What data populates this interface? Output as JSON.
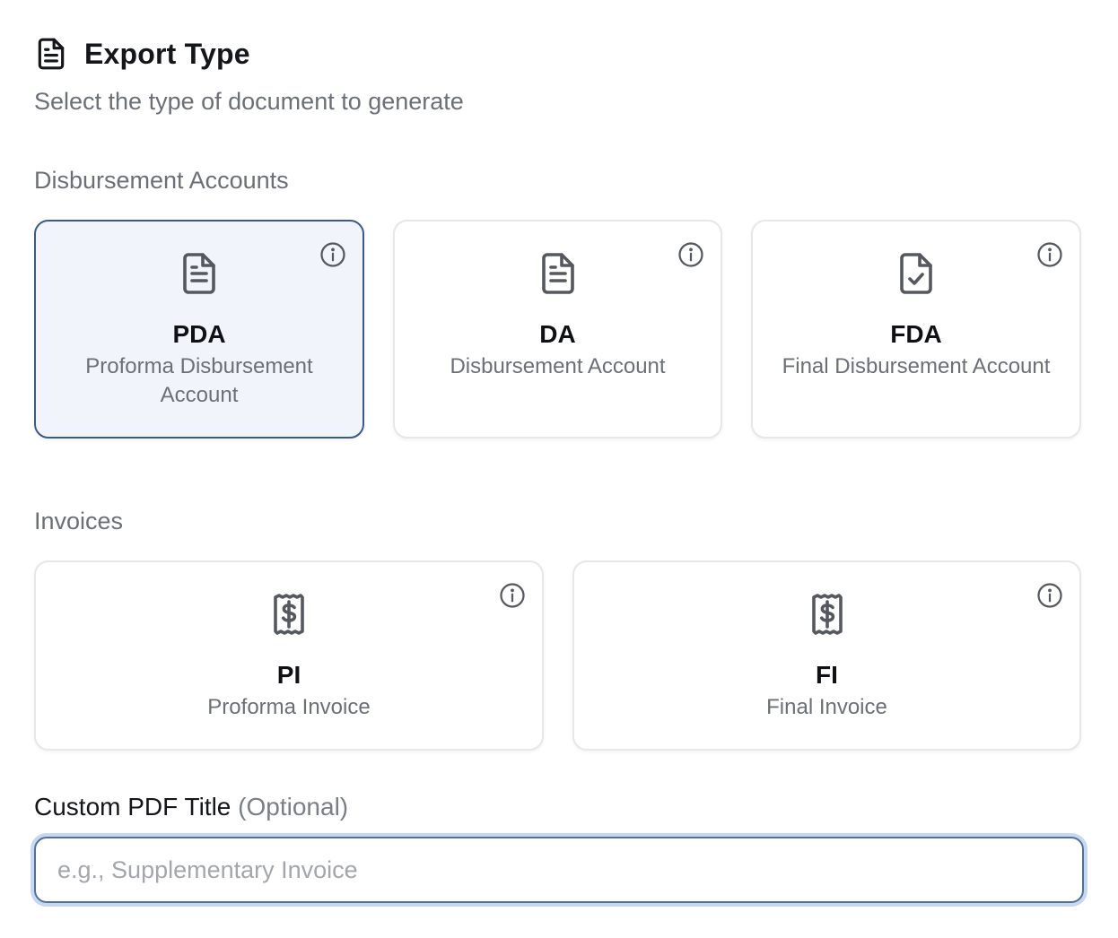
{
  "header": {
    "icon": "document-icon",
    "title": "Export Type",
    "subtitle": "Select the type of document to generate"
  },
  "sections": {
    "disbursement_label": "Disbursement Accounts",
    "invoices_label": "Invoices"
  },
  "disbursement_cards": [
    {
      "code": "PDA",
      "desc": "Proforma Disbursement Account",
      "icon": "document-lines-icon",
      "selected": true
    },
    {
      "code": "DA",
      "desc": "Disbursement Account",
      "icon": "document-lines-icon",
      "selected": false
    },
    {
      "code": "FDA",
      "desc": "Final Disbursement Account",
      "icon": "document-check-icon",
      "selected": false
    }
  ],
  "invoice_cards": [
    {
      "code": "PI",
      "desc": "Proforma Invoice",
      "icon": "receipt-dollar-icon",
      "selected": false
    },
    {
      "code": "FI",
      "desc": "Final Invoice",
      "icon": "receipt-dollar-icon",
      "selected": false
    }
  ],
  "custom_title": {
    "label": "Custom PDF Title",
    "optional": "(Optional)",
    "value": "",
    "placeholder": "e.g., Supplementary Invoice"
  },
  "colors": {
    "selected_border": "#3a5a8a",
    "selected_bg": "#f1f5fb",
    "focus_ring": "#c7d7f0"
  }
}
